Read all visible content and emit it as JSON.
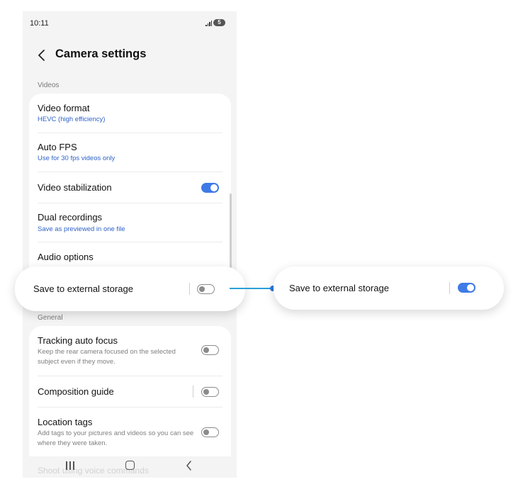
{
  "status_bar": {
    "time": "10:11",
    "battery": "5"
  },
  "header": {
    "title": "Camera settings"
  },
  "sections": {
    "videos_label": "Videos",
    "general_label": "General"
  },
  "videos": {
    "video_format": {
      "title": "Video format",
      "value": "HEVC (high efficiency)"
    },
    "auto_fps": {
      "title": "Auto FPS",
      "value": "Use for 30 fps videos only"
    },
    "video_stabilization": {
      "title": "Video stabilization",
      "enabled": true
    },
    "dual_recordings": {
      "title": "Dual recordings",
      "value": "Save as previewed in one file"
    },
    "audio_options": {
      "title": "Audio options"
    }
  },
  "general": {
    "tracking_auto_focus": {
      "title": "Tracking auto focus",
      "description": "Keep the rear camera focused on the selected subject even if they move.",
      "enabled": false
    },
    "composition_guide": {
      "title": "Composition guide",
      "enabled": false
    },
    "location_tags": {
      "title": "Location tags",
      "description": "Add tags to your pictures and videos so you can see where they were taken.",
      "enabled": false
    },
    "faded_item": "Shoot using voice commands"
  },
  "callouts": {
    "before": {
      "label": "Save to external storage",
      "enabled": false
    },
    "after": {
      "label": "Save to external storage",
      "enabled": true
    }
  },
  "colors": {
    "accent": "#3f7ae6",
    "connector": "#2b9fd9",
    "link_text": "#2f62c8"
  }
}
